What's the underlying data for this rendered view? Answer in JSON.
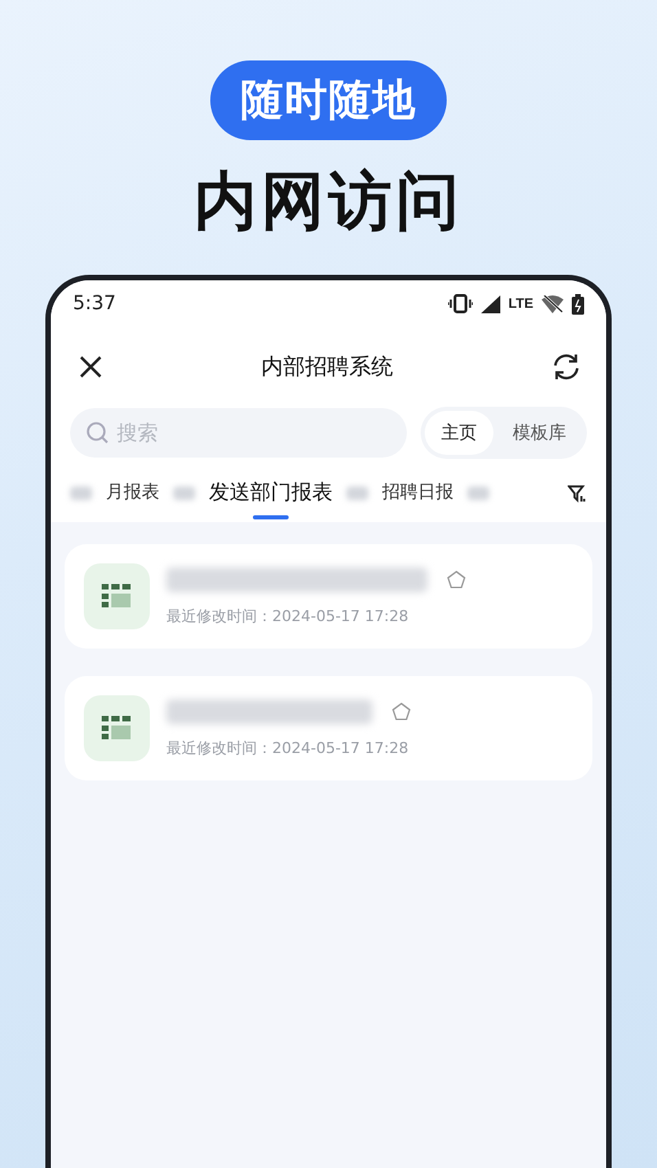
{
  "promo": {
    "badge": "随时随地",
    "headline": "内网访问"
  },
  "status_bar": {
    "time": "5:37",
    "network": "LTE"
  },
  "app_bar": {
    "title": "内部招聘系统"
  },
  "search": {
    "placeholder": "搜索"
  },
  "view_switch": [
    {
      "label": "主页",
      "selected": true
    },
    {
      "label": "模板库",
      "selected": false
    }
  ],
  "tabs": [
    {
      "label": "月报表",
      "selected": false
    },
    {
      "label": "发送部门报表",
      "selected": true
    },
    {
      "label": "招聘日报",
      "selected": false
    }
  ],
  "reports": [
    {
      "modified": "最近修改时间：2024-05-17 17:28",
      "starred": false
    },
    {
      "modified": "最近修改时间：2024-05-17 17:28",
      "starred": false
    }
  ]
}
